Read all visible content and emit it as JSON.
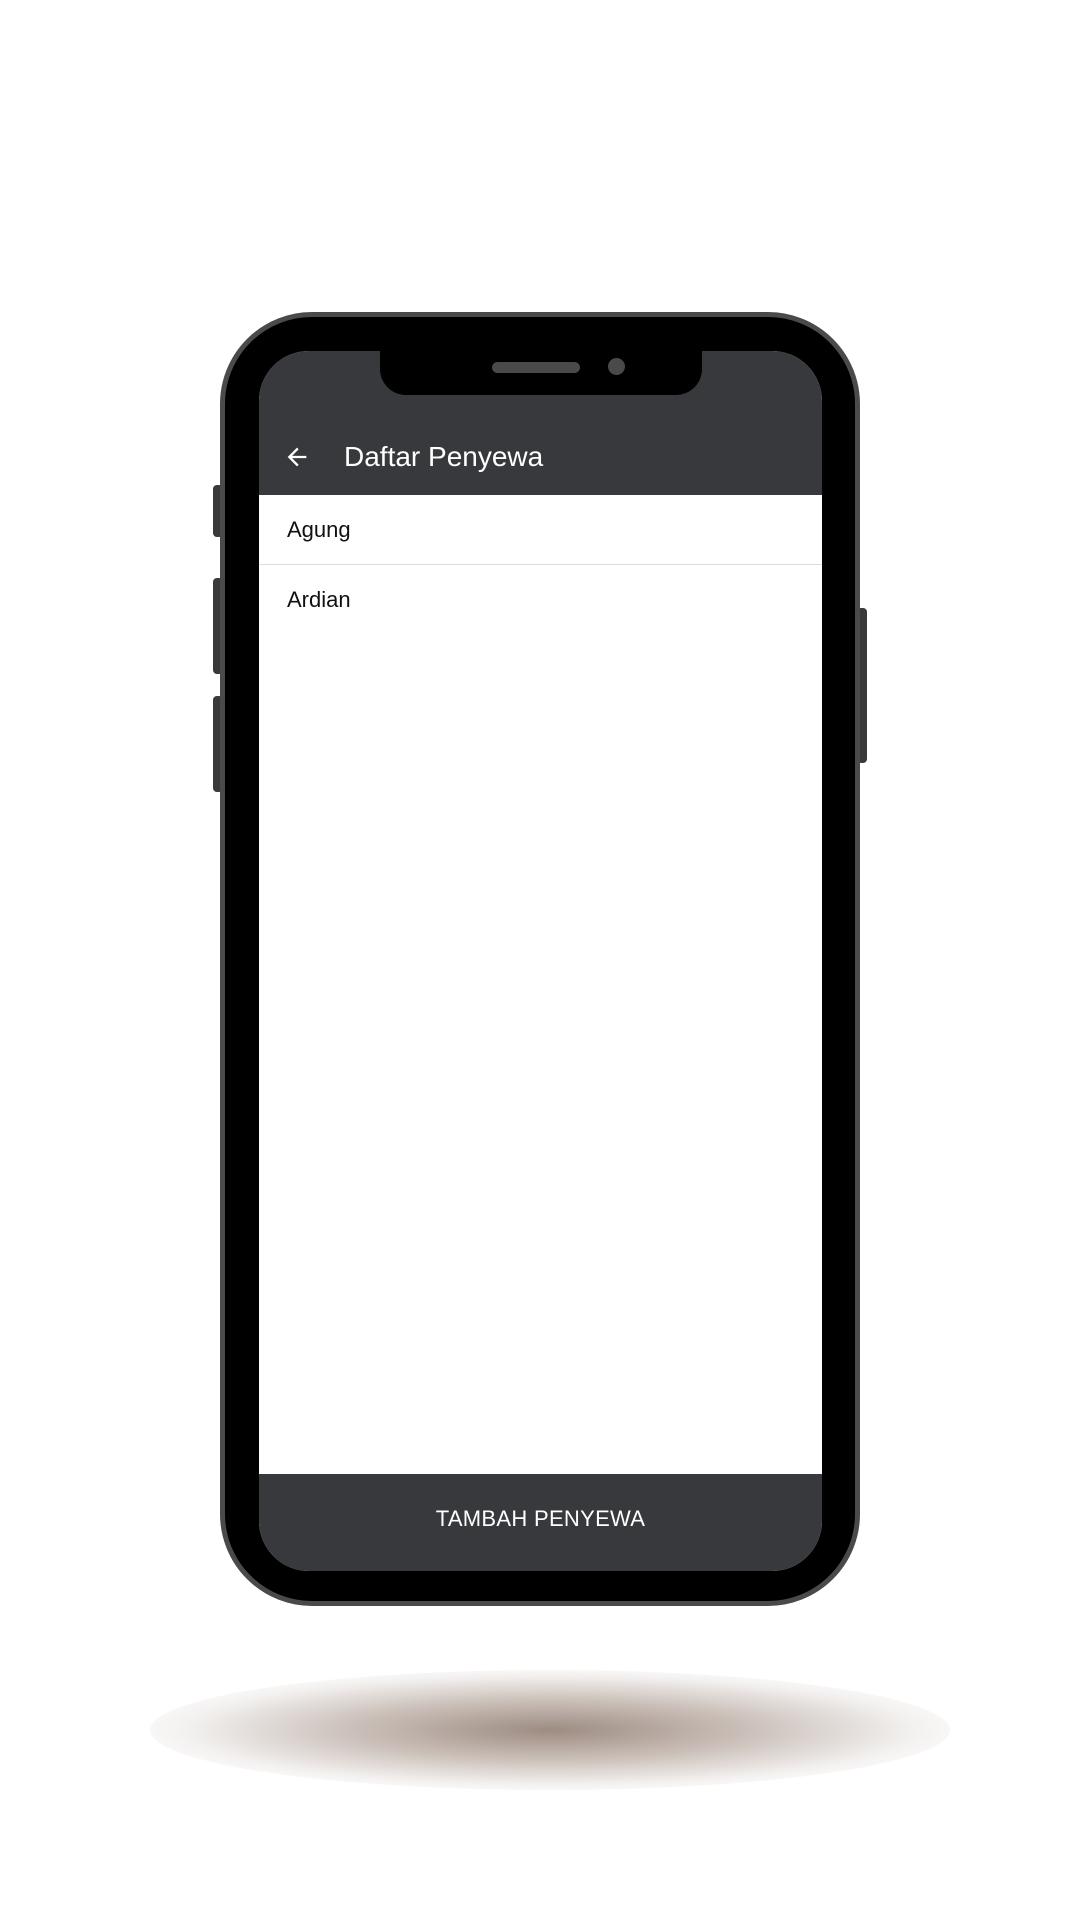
{
  "app_bar": {
    "title": "Daftar Penyewa",
    "back_icon": "arrow-left-icon",
    "background": "#38393c"
  },
  "tenants": [
    {
      "name": "Agung"
    },
    {
      "name": "Ardian"
    }
  ],
  "bottom_bar": {
    "button_label": "TAMBAH PENYEWA",
    "background": "#38393c"
  }
}
